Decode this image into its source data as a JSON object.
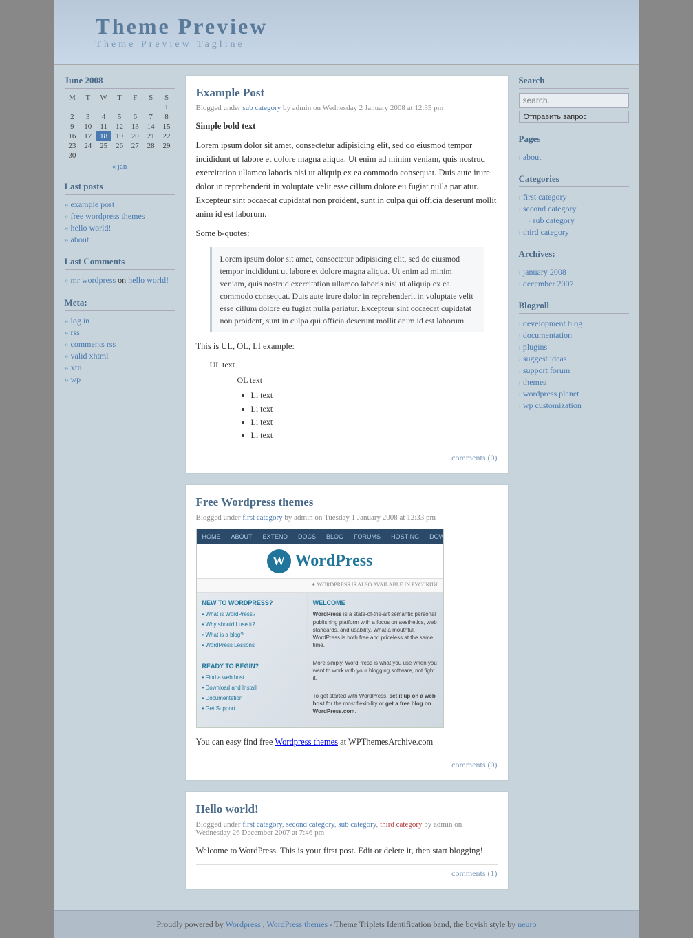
{
  "header": {
    "title": "Theme Preview",
    "tagline": "Theme Preview Tagline"
  },
  "sidebar_left": {
    "calendar": {
      "title": "June 2008",
      "days_header": [
        "M",
        "T",
        "W",
        "T",
        "F",
        "S",
        "S"
      ],
      "weeks": [
        [
          "",
          "",
          "",
          "",
          "",
          "",
          "1"
        ],
        [
          "2",
          "3",
          "4",
          "5",
          "6",
          "7",
          "8"
        ],
        [
          "9",
          "10",
          "11",
          "12",
          "13",
          "14",
          "15"
        ],
        [
          "16",
          "17",
          "18",
          "19",
          "20",
          "21",
          "22"
        ],
        [
          "23",
          "24",
          "25",
          "26",
          "27",
          "28",
          "29"
        ],
        [
          "30",
          "",
          "",
          "",
          "",
          "",
          ""
        ]
      ],
      "today": "18",
      "prev_nav": "« jan"
    },
    "last_posts": {
      "title": "Last posts",
      "items": [
        {
          "label": "example post",
          "href": "#"
        },
        {
          "label": "free wordpress themes",
          "href": "#"
        },
        {
          "label": "hello world!",
          "href": "#"
        },
        {
          "label": "about",
          "href": "#"
        }
      ]
    },
    "last_comments": {
      "title": "Last Comments",
      "items": [
        {
          "text": "mr wordpress on hello world!"
        }
      ]
    },
    "meta": {
      "title": "Meta:",
      "items": [
        {
          "label": "log in",
          "href": "#"
        },
        {
          "label": "rss",
          "href": "#"
        },
        {
          "label": "comments rss",
          "href": "#"
        },
        {
          "label": "valid xhtml",
          "href": "#"
        },
        {
          "label": "xfn",
          "href": "#"
        },
        {
          "label": "wp",
          "href": "#"
        }
      ]
    }
  },
  "posts": [
    {
      "id": "example-post",
      "title": "Example Post",
      "category": "sub category",
      "category_href": "#",
      "meta": "Blogged under sub category by admin on Wednesday 2 January 2008 at 12:35 pm",
      "content_heading": "Simple bold text",
      "paragraph1": "Lorem ipsum dolor sit amet, consectetur adipisicing elit, sed do eiusmod tempor incididunt ut labore et dolore magna aliqua. Ut enim ad minim veniam, quis nostrud exercitation ullamco laboris nisi ut aliquip ex ea commodo consequat. Duis aute irure dolor in reprehenderit in voluptate velit esse cillum dolore eu fugiat nulla pariatur. Excepteur sint occaecat cupidatat non proident, sunt in culpa qui officia deserunt mollit anim id est laborum.",
      "bquote_label": "Some b-quotes:",
      "blockquote": "Lorem ipsum dolor sit amet, consectetur adipisicing elit, sed do eiusmod tempor incididunt ut labore et dolore magna aliqua. Ut enim ad minim veniam, quis nostrud exercitation ullamco laboris nisi ut aliquip ex ea commodo consequat. Duis aute irure dolor in reprehenderit in voluptate velit esse cillum dolore eu fugiat nulla pariatur. Excepteur sint occaecat cupidatat non proident, sunt in culpa qui officia deserunt mollit anim id est laborum.",
      "list_label": "This is UL, OL, LI example:",
      "ul_text": "UL text",
      "ol_text": "OL text",
      "li_items": [
        "Li text",
        "Li text",
        "Li text",
        "Li text"
      ],
      "comments": "comments (0)"
    },
    {
      "id": "free-wordpress-themes",
      "title": "Free Wordpress themes",
      "category": "first category",
      "category_href": "#",
      "meta": "Blogged under first category by admin on Tuesday 1 January 2008 at 12:33 pm",
      "body_text1": "You can easy find free",
      "wp_themes_link": "Wordpress themes",
      "body_text2": "at WPThemesArchive.com",
      "comments": "comments (0)"
    },
    {
      "id": "hello-world",
      "title": "Hello world!",
      "categories": "first category, second category, sub category, third category",
      "meta_text": "Blogged under",
      "cat1": "first category",
      "cat2": "second category",
      "cat3": "sub category",
      "cat4": "third category",
      "meta_suffix": "by admin on Wednesday 26 December 2007 at 7:46 pm",
      "body": "Welcome to WordPress. This is your first post. Edit or delete it, then start blogging!",
      "comments": "comments (1)"
    }
  ],
  "sidebar_right": {
    "search": {
      "title": "Search",
      "placeholder": "search...",
      "button_label": "Отправить запрос"
    },
    "pages": {
      "title": "Pages",
      "items": [
        {
          "label": "about",
          "href": "#"
        }
      ]
    },
    "categories": {
      "title": "Categories",
      "items": [
        {
          "label": "first category",
          "href": "#",
          "sub": false
        },
        {
          "label": "second category",
          "href": "#",
          "sub": false
        },
        {
          "label": "sub category",
          "href": "#",
          "sub": true
        },
        {
          "label": "third category",
          "href": "#",
          "sub": false
        }
      ]
    },
    "archives": {
      "title": "Archives:",
      "items": [
        {
          "label": "january 2008",
          "href": "#"
        },
        {
          "label": "december 2007",
          "href": "#"
        }
      ]
    },
    "blogroll": {
      "title": "Blogroll",
      "items": [
        {
          "label": "development blog",
          "href": "#"
        },
        {
          "label": "documentation",
          "href": "#"
        },
        {
          "label": "plugins",
          "href": "#"
        },
        {
          "label": "suggest ideas",
          "href": "#"
        },
        {
          "label": "support forum",
          "href": "#"
        },
        {
          "label": "themes",
          "href": "#"
        },
        {
          "label": "wordpress planet",
          "href": "#"
        },
        {
          "label": "wp customization",
          "href": "#"
        }
      ]
    }
  },
  "footer": {
    "text1": "Proudly powered by",
    "wordpress_link": "Wordpress",
    "text2": ",",
    "themes_link": "WordPress themes",
    "text3": "- Theme Triplets Identification band, the boyish style by",
    "neuro_link": "neuro"
  }
}
